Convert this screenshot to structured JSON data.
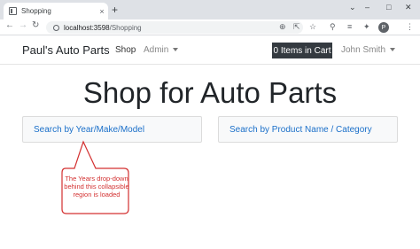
{
  "browser": {
    "tab_title": "Shopping",
    "tab_close": "×",
    "new_tab": "+",
    "url_host": "localhost:3598",
    "url_path": "/Shopping",
    "profile_initial": "P",
    "icons": [
      "back-icon",
      "forward-icon",
      "reload-icon",
      "info-icon",
      "zoom-icon",
      "share-icon",
      "bookmark-star-icon",
      "extension-icon",
      "media-icon",
      "profile-avatar",
      "menu-icon"
    ]
  },
  "navbar": {
    "brand": "Paul's Auto Parts",
    "shop": "Shop",
    "admin": "Admin",
    "cart": "0 Items in Cart",
    "user": "John Smith"
  },
  "main": {
    "heading": "Shop for Auto Parts",
    "panel_left": "Search by Year/Make/Model",
    "panel_right": "Search by Product Name / Category"
  },
  "callout": {
    "text": "The Years drop-down behind this collapsible region is loaded"
  },
  "colors": {
    "link": "#1a6fc9",
    "callout": "#d33030",
    "cart_bg": "#343a40"
  }
}
